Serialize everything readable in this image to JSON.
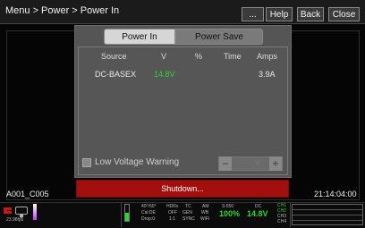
{
  "topbar": {
    "breadcrumb": "Menu > Power > Power In",
    "buttons": {
      "more": "...",
      "help": "Help",
      "back": "Back",
      "close": "Close"
    }
  },
  "tabs": {
    "power_in": "Power In",
    "power_save": "Power Save"
  },
  "table": {
    "headers": [
      "Source",
      "V",
      "%",
      "Time",
      "Amps"
    ],
    "rows": [
      {
        "source": "DC-BASEX",
        "v": "14.8V",
        "pct": "",
        "time": "",
        "amps": "3.9A"
      }
    ]
  },
  "low_voltage": {
    "label": "Low Voltage Warning",
    "checked": false,
    "stepper_value": "V"
  },
  "shutdown_label": "Shutdown...",
  "clip_name": "A001_C005",
  "timecode": "21:14:04:00",
  "status": {
    "fps": "23.98fps",
    "shutter": "40°/50°",
    "cal": "Cal:DE",
    "drop": "Drop:0",
    "hdrx": "HDRx",
    "off": "OFF",
    "ratio": "1:1",
    "tc": "TC",
    "gen": "GEN",
    "sync": "SYNC",
    "am": "AM",
    "wb": "WB",
    "wifi": "WiFi",
    "media_label": "S:550",
    "media_pct": "100%",
    "dc_label": "DC",
    "dc_volts": "14.8V",
    "channels": [
      "CH1",
      "CH2",
      "CH3",
      "CH4"
    ]
  },
  "colors": {
    "accent_green": "#2fd52f",
    "shutdown_red": "#a30e0e"
  }
}
